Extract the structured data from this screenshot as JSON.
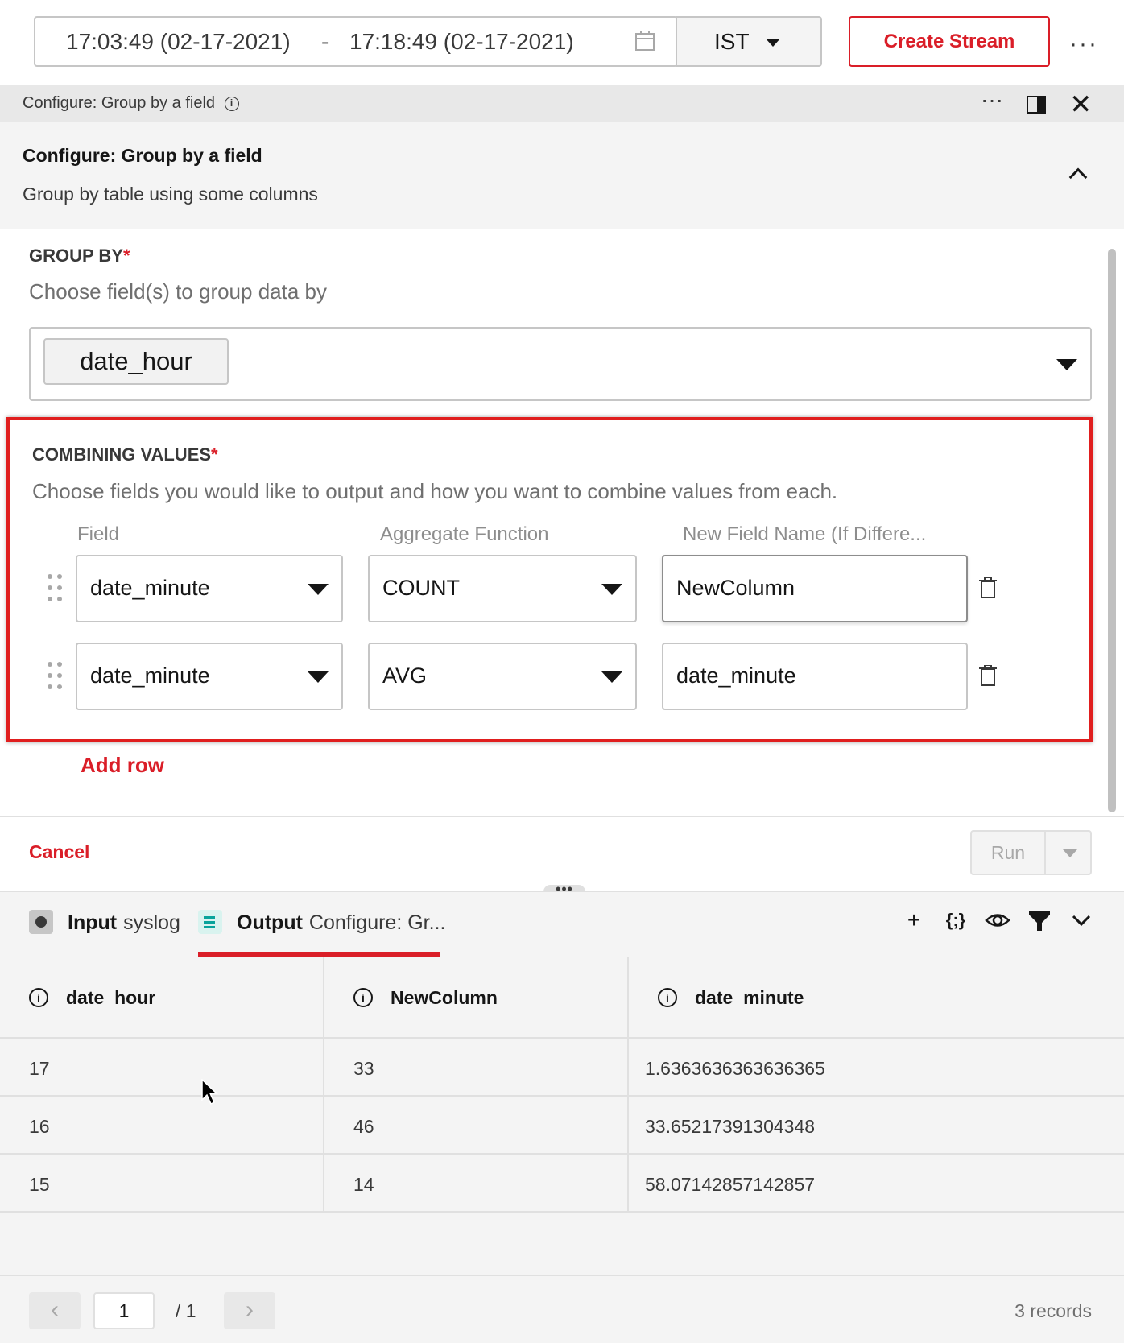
{
  "topbar": {
    "start_time": "17:03:49 (02-17-2021)",
    "separator": "-",
    "end_time": "17:18:49 (02-17-2021)",
    "timezone": "IST",
    "create_stream_label": "Create Stream",
    "more_label": "···"
  },
  "panel_header": {
    "title": "Configure: Group by a field",
    "more_label": "···"
  },
  "config": {
    "heading": "Configure: Group by a field",
    "description": "Group by table using some columns"
  },
  "group_by": {
    "label": "GROUP BY",
    "required_mark": "*",
    "help": "Choose field(s) to group data by",
    "selected_tag": "date_hour"
  },
  "combining_values": {
    "label": "COMBINING VALUES",
    "required_mark": "*",
    "help": "Choose fields you would like to output and how you want to combine values from each.",
    "columns": [
      "Field",
      "Aggregate Function",
      "New Field Name (If Differe..."
    ],
    "rows": [
      {
        "field": "date_minute",
        "function": "COUNT",
        "new_name": "NewColumn"
      },
      {
        "field": "date_minute",
        "function": "AVG",
        "new_name": "date_minute"
      }
    ],
    "add_row_label": "Add row"
  },
  "footer": {
    "cancel_label": "Cancel",
    "run_label": "Run"
  },
  "output_tabs": {
    "input_bold": "Input",
    "input_name": "syslog",
    "output_bold": "Output",
    "output_name": "Configure: Gr..."
  },
  "table": {
    "headers": [
      "date_hour",
      "NewColumn",
      "date_minute"
    ],
    "rows": [
      [
        "17",
        "33",
        "1.6363636363636365"
      ],
      [
        "16",
        "46",
        "33.65217391304348"
      ],
      [
        "15",
        "14",
        "58.07142857142857"
      ]
    ]
  },
  "pager": {
    "current_page": "1",
    "total_pages": "/ 1",
    "records": "3 records"
  },
  "colors": {
    "accent_red": "#da1e28",
    "highlight_red": "#e01e1e",
    "teal": "#08a39b"
  },
  "icons": [
    "calendar-icon",
    "caret-down-icon",
    "info-icon",
    "split-view-icon",
    "close-icon",
    "chevron-up-icon",
    "drag-handle-icon",
    "trash-icon",
    "plus-icon",
    "json-icon",
    "eye-icon",
    "filter-icon",
    "chevron-down-icon",
    "arrow-left-icon",
    "arrow-right-icon"
  ]
}
